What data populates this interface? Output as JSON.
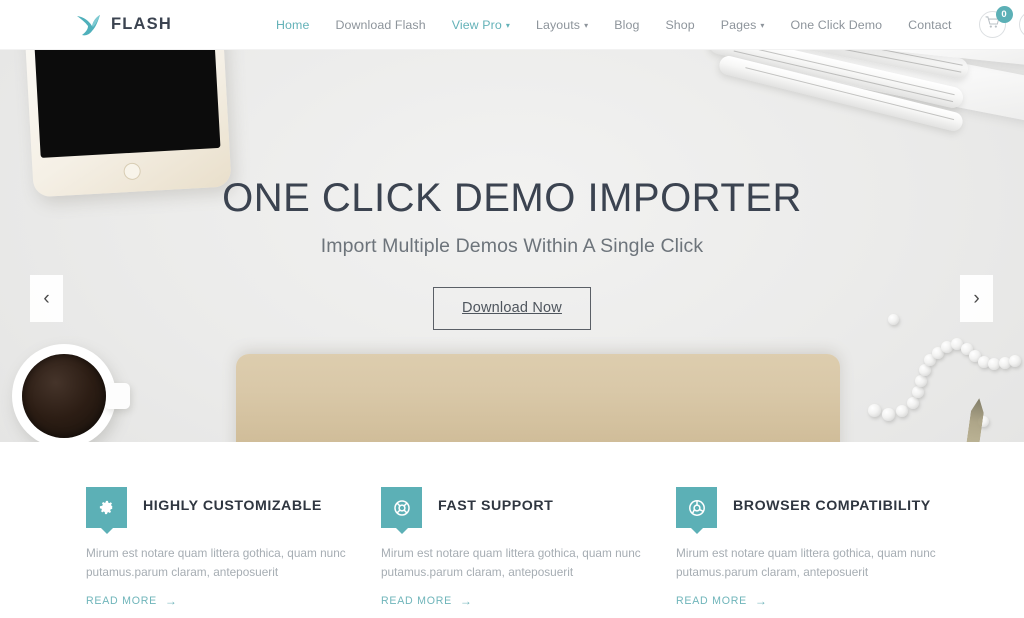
{
  "header": {
    "logo_text": "FLASH",
    "logo_icon": "bird-logo-icon",
    "nav": [
      {
        "label": "Home",
        "state": "active",
        "has_caret": false
      },
      {
        "label": "Download Flash",
        "state": "default",
        "has_caret": false
      },
      {
        "label": "View Pro",
        "state": "accent",
        "has_caret": true
      },
      {
        "label": "Layouts",
        "state": "default",
        "has_caret": true
      },
      {
        "label": "Blog",
        "state": "default",
        "has_caret": false
      },
      {
        "label": "Shop",
        "state": "default",
        "has_caret": false
      },
      {
        "label": "Pages",
        "state": "default",
        "has_caret": true
      },
      {
        "label": "One Click Demo",
        "state": "default",
        "has_caret": false
      },
      {
        "label": "Contact",
        "state": "default",
        "has_caret": false
      }
    ],
    "caret_glyph": "▾",
    "cart": {
      "icon": "shopping-cart-icon",
      "count": "0"
    },
    "search": {
      "icon": "search-icon"
    }
  },
  "hero": {
    "title": "ONE CLICK DEMO IMPORTER",
    "subtitle": "Import Multiple Demos Within A Single Click",
    "button_label": "Download Now",
    "prev_glyph": "‹",
    "next_glyph": "›",
    "prev_name": "slider-prev-arrow",
    "next_name": "slider-next-arrow"
  },
  "features": [
    {
      "icon": "gear-icon",
      "title": "HIGHLY CUSTOMIZABLE",
      "text": "Mirum est notare quam littera gothica, quam nunc putamus.parum claram, anteposuerit",
      "link_label": "READ MORE",
      "link_arrow": "→"
    },
    {
      "icon": "lifebuoy-icon",
      "title": "FAST SUPPORT",
      "text": "Mirum est notare quam littera gothica, quam nunc putamus.parum claram, anteposuerit",
      "link_label": "READ MORE",
      "link_arrow": "→"
    },
    {
      "icon": "chrome-browser-icon",
      "title": "BROWSER COMPATIBILITY",
      "text": "Mirum est notare quam littera gothica, quam nunc putamus.parum claram, anteposuerit",
      "link_label": "READ MORE",
      "link_arrow": "→"
    }
  ],
  "colors": {
    "accent_teal": "#5cb0b6",
    "nav_text": "#8d949b",
    "heading_dark": "#3b4350",
    "body_gray": "#a6adb3",
    "hero_bg": "#ebebea",
    "notebook_tan": "#d9c8a8"
  }
}
